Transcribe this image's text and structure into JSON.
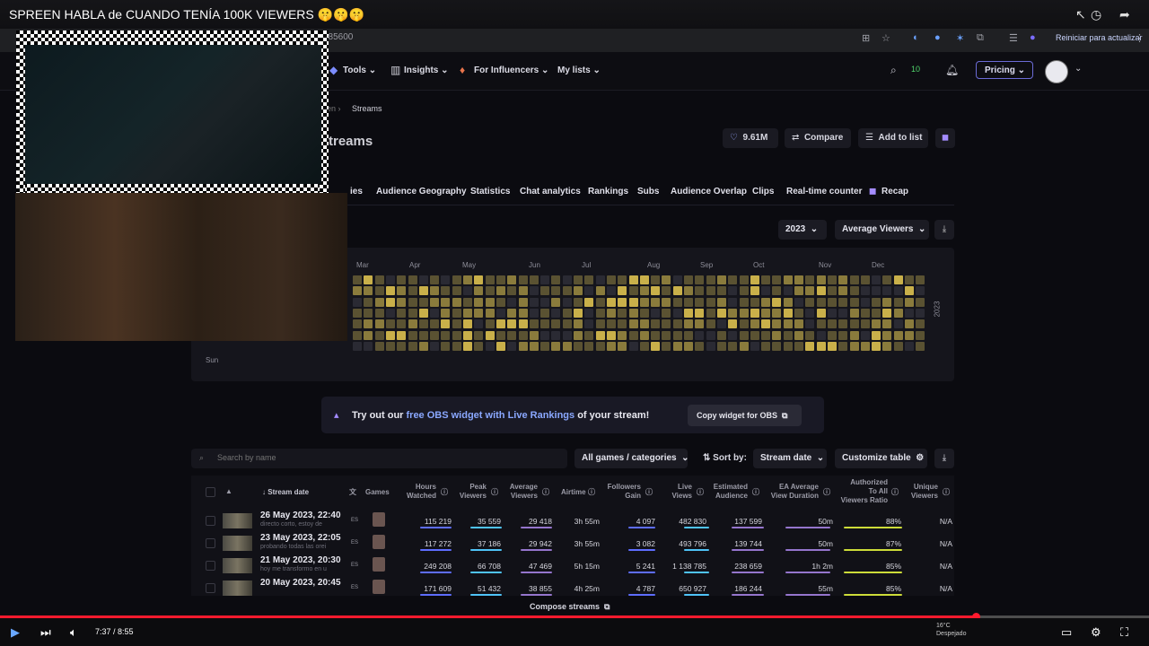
{
  "video": {
    "title": "SPREEN HABLA de CUANDO TENÍA 100K VIEWERS 🤫🤫🤫",
    "time": "7:37 / 8:55",
    "progress": 0.85
  },
  "browser": {
    "url_fragment": "985600",
    "restart_label": "Reiniciar para actualizar"
  },
  "nav": {
    "tools": "Tools",
    "insights": "Insights",
    "for_influencers": "For Influencers",
    "my_lists": "My lists",
    "pricing": "Pricing",
    "notif_badge": "10"
  },
  "breadcrumb": {
    "prev": "en",
    "current": "Streams"
  },
  "page": {
    "title": "treams",
    "followers": "9.61M",
    "compare": "Compare",
    "add_to_list": "Add to list"
  },
  "tabs": [
    "ies",
    "Audience Geography",
    "Statistics",
    "Chat analytics",
    "Rankings",
    "Subs",
    "Audience Overlap",
    "Clips",
    "Real-time counter",
    "Recap"
  ],
  "heatmap": {
    "year_select": "2023",
    "metric_select": "Average Viewers",
    "months": [
      "Mar",
      "Apr",
      "May",
      "Jun",
      "Jul",
      "Aug",
      "Sep",
      "Oct",
      "Nov",
      "Dec"
    ],
    "day_label": "Sun",
    "year_label": "2023",
    "colors": {
      "empty": "#2a2a33",
      "low": "#5a5232",
      "mid": "#8a7b3c",
      "high": "#c9b04a"
    }
  },
  "obs_banner": {
    "prefix": "Try out our ",
    "link": "free OBS widget with Live Rankings",
    "suffix": " of your stream!",
    "button": "Copy widget for OBS"
  },
  "filters": {
    "search_placeholder": "Search by name",
    "games": "All games / categories",
    "sort_label": "Sort by:",
    "sort_value": "Stream date",
    "customize": "Customize table"
  },
  "table": {
    "headers": {
      "stream_date": "Stream date",
      "games": "Games",
      "hours_watched": [
        "Hours",
        "Watched"
      ],
      "peak_viewers": [
        "Peak",
        "Viewers"
      ],
      "average_viewers": [
        "Average",
        "Viewers"
      ],
      "airtime": "Airtime",
      "followers_gain": [
        "Followers",
        "Gain"
      ],
      "live_views": [
        "Live",
        "Views"
      ],
      "estimated_audience": [
        "Estimated",
        "Audience"
      ],
      "ea_duration": [
        "EA Average",
        "View Duration"
      ],
      "authorized": [
        "Authorized",
        "To All",
        "Viewers Ratio"
      ],
      "unique": [
        "Unique",
        "Viewers"
      ]
    },
    "rows": [
      {
        "date": "26 May 2023, 22:40",
        "sub": "directo corto, estoy de",
        "lang": "ES",
        "hours": "115 219",
        "peak": "35 559",
        "avg": "29 418",
        "airtime": "3h 55m",
        "followers": "4 097",
        "live": "482 830",
        "est": "137 599",
        "ea": "50m",
        "auth": "88%",
        "unique": "N/A"
      },
      {
        "date": "23 May 2023, 22:05",
        "sub": "probando todas las orei",
        "lang": "ES",
        "hours": "117 272",
        "peak": "37 186",
        "avg": "29 942",
        "airtime": "3h 55m",
        "followers": "3 082",
        "live": "493 796",
        "est": "139 744",
        "ea": "50m",
        "auth": "87%",
        "unique": "N/A"
      },
      {
        "date": "21 May 2023, 20:30",
        "sub": "hoy me transformo en u",
        "lang": "ES",
        "hours": "249 208",
        "peak": "66 708",
        "avg": "47 469",
        "airtime": "5h 15m",
        "followers": "5 241",
        "live": "1 138 785",
        "est": "238 659",
        "ea": "1h 2m",
        "auth": "85%",
        "unique": "N/A"
      },
      {
        "date": "20 May 2023, 20:45",
        "sub": "",
        "lang": "ES",
        "hours": "171 609",
        "peak": "51 432",
        "avg": "38 855",
        "airtime": "4h 25m",
        "followers": "4 787",
        "live": "650 927",
        "est": "186 244",
        "ea": "55m",
        "auth": "85%",
        "unique": "N/A"
      }
    ],
    "compose": "Compose streams"
  },
  "taskbar": {
    "temp": "16°C",
    "weather": "Despejado"
  }
}
